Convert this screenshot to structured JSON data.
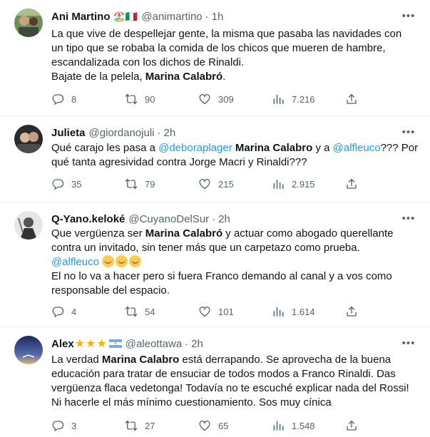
{
  "tweets": [
    {
      "name": "Ani Martino",
      "emoji": "🏖️🇮🇹",
      "handle": "@animartino",
      "time": "1h",
      "lines": [
        "La que vive de despellejar gente, la misma que pasaba las navidades con",
        "un tipo que se robaba la comida de los chicos que mueren de hambre,",
        "escandalizada con los dichos de Rinaldi."
      ],
      "last_line_prefix": "Bajate de la pelela, ",
      "last_line_bold": "Marina Calabró",
      "last_line_suffix": ".",
      "stats": {
        "replies": "8",
        "retweets": "90",
        "likes": "309",
        "views": "7.216"
      }
    },
    {
      "name": "Julieta",
      "handle": "@giordanojuli",
      "time": "2h",
      "seg1": "Qué carajo les pasa a ",
      "mention1": "@deboraplager",
      "seg2": " ",
      "bold1": "Marina Calabro",
      "seg3": " y a ",
      "mention2": "@alfleuco",
      "seg4": "??? Por",
      "line2": "qué tanta agresividad contra Jorge Macri y Rinaldi???",
      "stats": {
        "replies": "35",
        "retweets": "79",
        "likes": "215",
        "views": "2.915"
      }
    },
    {
      "name": "Q-Yano.keloké",
      "handle": "@CuyanoDelSur",
      "time": "2h",
      "l1a": "Que vergüenza ser ",
      "l1b": "Marina Calabró",
      "l1c": " y actuar como abogado querellante",
      "line2": "contra un invitado, sin tener más que un carpetazo como prueba.",
      "mention": "@alfleuco",
      "line4": "El no lo va a hacer pero si fuera Franco demando al canal y a vos como",
      "line5": "responsable del espacio.",
      "stats": {
        "replies": "4",
        "retweets": "54",
        "likes": "101",
        "views": "1.614"
      }
    },
    {
      "name": "Alex",
      "handle": "@aleottawa",
      "time": "2h",
      "l1a": "La verdad ",
      "l1b": "Marina Calabro",
      "l1c": " está derrapando.  Se aprovecha de la buena",
      "line2": "educación para tratar de ensuciar de todos modos a Franco Rinaldi.  Das",
      "line3": "vergüenza flaca vedetonga! Todavía no te escuché explicar nada del Rossi!",
      "line4": "Ni hacerle el más mínimo cuestionamiento.  Sos muy cínica",
      "stats": {
        "replies": "3",
        "retweets": "27",
        "likes": "65",
        "views": "1.548"
      }
    }
  ],
  "ui": {
    "dot": "·",
    "more": "•••"
  }
}
